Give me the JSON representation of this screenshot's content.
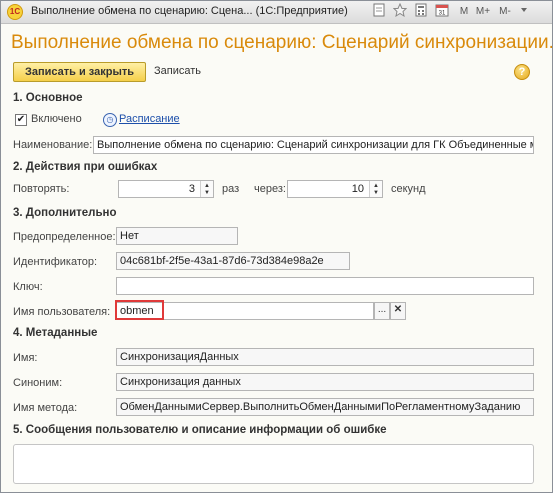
{
  "window": {
    "title": "Выполнение обмена по сценарию: Сцена... (1С:Предприятие)",
    "app_icon": "1c-icon",
    "toolbar_icons": [
      "document-icon",
      "star-icon",
      "calculator-icon",
      "calendar-icon",
      "M",
      "M+",
      "M-"
    ]
  },
  "form": {
    "title": "Выполнение обмена по сценарию: Сценарий синхронизации...",
    "buttons": {
      "save_close": "Записать и закрыть",
      "save": "Записать",
      "help": "?"
    }
  },
  "sections": {
    "basic": "1. Основное",
    "errors": "2. Действия при ошибках",
    "extra": "3. Дополнительно",
    "metadata": "4. Метаданные",
    "messages": "5. Сообщения пользователю и описание информации об ошибке"
  },
  "basic": {
    "enabled_label": "Включено",
    "enabled": true,
    "schedule_link": "Расписание",
    "name_label": "Наименование:",
    "name_value": "Выполнение обмена по сценарию: Сценарий синхронизации для ГК Объединенные м"
  },
  "errors": {
    "repeat_label": "Повторять:",
    "repeat_value": "3",
    "times_label": "раз",
    "through_label": "через:",
    "interval_value": "10",
    "seconds_label": "секунд"
  },
  "extra": {
    "predefined_label": "Предопределенное:",
    "predefined_value": "Нет",
    "id_label": "Идентификатор:",
    "id_value": "04c681bf-2f5e-43a1-87d6-73d384e98a2e",
    "key_label": "Ключ:",
    "key_value": "",
    "user_label": "Имя пользователя:",
    "user_value": "obmen",
    "choose_btn": "...",
    "clear_btn": "✕"
  },
  "metadata": {
    "name_label": "Имя:",
    "name_value": "СинхронизацияДанных",
    "synonym_label": "Синоним:",
    "synonym_value": "Синхронизация данных",
    "method_label": "Имя метода:",
    "method_value": "ОбменДаннымиСервер.ВыполнитьОбменДаннымиПоРегламентномуЗаданию"
  },
  "colors": {
    "title": "#d98a0b",
    "highlight": "#e03a3a",
    "link": "#1d4faa"
  }
}
